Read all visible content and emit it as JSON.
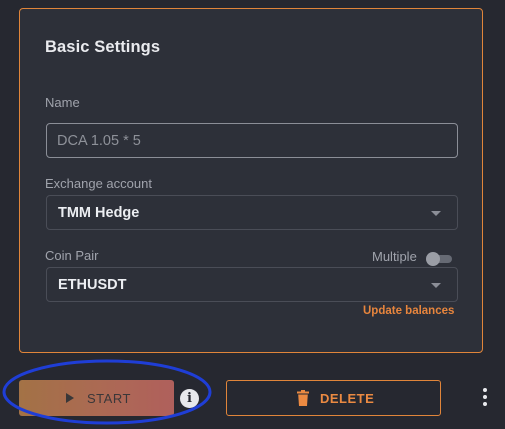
{
  "settings": {
    "title": "Basic Settings",
    "name": {
      "label": "Name",
      "placeholder": "DCA 1.05 * 5",
      "value": ""
    },
    "exchange_account": {
      "label": "Exchange account",
      "value": "TMM Hedge"
    },
    "coin_pair": {
      "label": "Coin Pair",
      "value": "ETHUSDT",
      "multiple_label": "Multiple",
      "multiple_enabled": false
    },
    "update_balances_label": "Update balances"
  },
  "actions": {
    "start_label": "START",
    "delete_label": "DELETE"
  },
  "icons": {
    "start": "play-icon",
    "info": "info-icon",
    "delete": "trash-icon",
    "more": "more-vertical-icon",
    "dropdown": "chevron-down-icon"
  },
  "colors": {
    "accent": "#e0853a",
    "background": "#262830",
    "panel": "#2d3039",
    "annotation": "#1f3ed6"
  }
}
